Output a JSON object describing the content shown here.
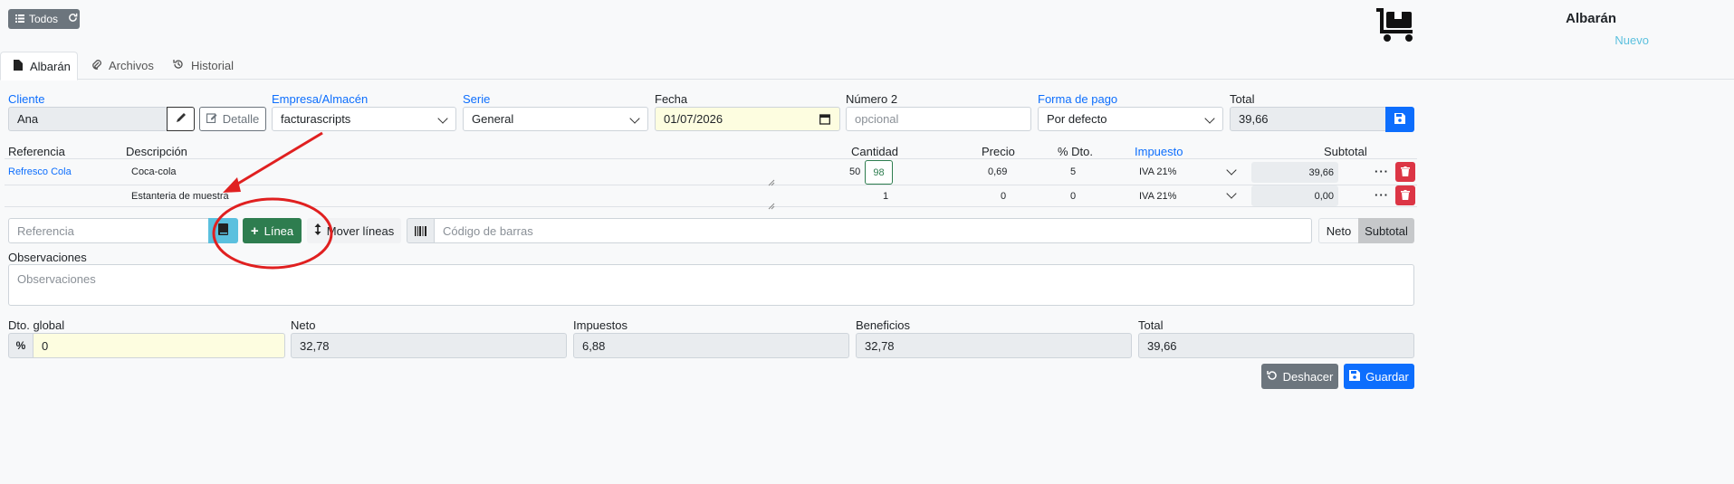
{
  "topbar": {
    "todos_label": "Todos"
  },
  "header": {
    "title": "Albarán",
    "status": "Nuevo"
  },
  "tabs": [
    {
      "label": "Albarán"
    },
    {
      "label": "Archivos"
    },
    {
      "label": "Historial"
    }
  ],
  "form": {
    "cliente": {
      "label": "Cliente",
      "value": "Ana",
      "detalle_label": "Detalle"
    },
    "empresa": {
      "label": "Empresa/Almacén",
      "value": "facturascripts"
    },
    "serie": {
      "label": "Serie",
      "value": "General"
    },
    "fecha": {
      "label": "Fecha",
      "value": "01/07/2026"
    },
    "numero2": {
      "label": "Número 2",
      "placeholder": "opcional"
    },
    "forma_pago": {
      "label": "Forma de pago",
      "value": "Por defecto"
    },
    "total": {
      "label": "Total",
      "value": "39,66"
    }
  },
  "lines": {
    "headers": {
      "referencia": "Referencia",
      "descripcion": "Descripción",
      "cantidad": "Cantidad",
      "precio": "Precio",
      "dto": "% Dto.",
      "impuesto": "Impuesto",
      "subtotal": "Subtotal"
    },
    "rows": [
      {
        "referencia": "Refresco Cola",
        "descripcion": "Coca-cola",
        "stock": "50",
        "cantidad": "98",
        "precio": "0,69",
        "dto": "5",
        "impuesto": "IVA 21%",
        "subtotal": "39,66"
      },
      {
        "referencia": "",
        "descripcion": "Estanteria de muestra",
        "stock": "",
        "cantidad": "1",
        "precio": "0",
        "dto": "0",
        "impuesto": "IVA 21%",
        "subtotal": "0,00"
      }
    ]
  },
  "toolbar": {
    "referencia_placeholder": "Referencia",
    "linea_label": "Línea",
    "mover_label": "Mover líneas",
    "barcode_placeholder": "Código de barras",
    "neto_label": "Neto",
    "subtotal_label": "Subtotal"
  },
  "observaciones": {
    "label": "Observaciones",
    "placeholder": "Observaciones"
  },
  "totals": {
    "dto_global": {
      "label": "Dto. global",
      "value": "0"
    },
    "neto": {
      "label": "Neto",
      "value": "32,78"
    },
    "impuestos": {
      "label": "Impuestos",
      "value": "6,88"
    },
    "beneficios": {
      "label": "Beneficios",
      "value": "32,78"
    },
    "total": {
      "label": "Total",
      "value": "39,66"
    }
  },
  "actions": {
    "deshacer_label": "Deshacer",
    "guardar_label": "Guardar"
  },
  "colors": {
    "primary": "#0d6efd",
    "success": "#2e7d4f",
    "danger": "#dc3545",
    "info": "#5bc0de",
    "annotation": "#e02020"
  }
}
